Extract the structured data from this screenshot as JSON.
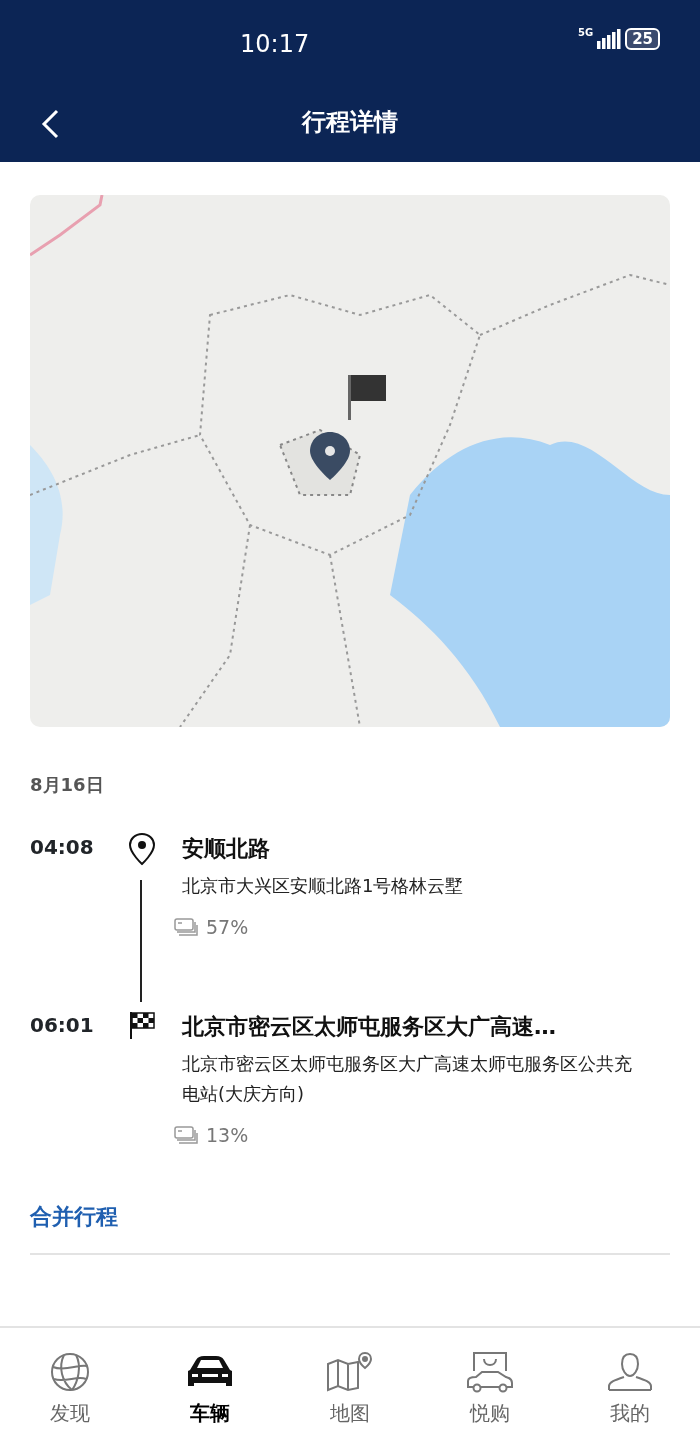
{
  "status_bar": {
    "time": "10:17",
    "network": "5G",
    "battery": "25"
  },
  "header": {
    "title": "行程详情"
  },
  "trip": {
    "date": "8月16日",
    "stops": [
      {
        "kind": "start",
        "time": "04:08",
        "name": "安顺北路",
        "address": "北京市大兴区安顺北路1号格林云墅",
        "battery": "57%"
      },
      {
        "kind": "end",
        "time": "06:01",
        "name": "北京市密云区太师屯服务区大广高速…",
        "address": "北京市密云区太师屯服务区大广高速太师屯服务区公共充电站(大庆方向)",
        "battery": "13%"
      }
    ],
    "merge_link": "合并行程"
  },
  "tabs": [
    {
      "label": "发现",
      "selected": false
    },
    {
      "label": "车辆",
      "selected": true
    },
    {
      "label": "地图",
      "selected": false
    },
    {
      "label": "悦购",
      "selected": false
    },
    {
      "label": "我的",
      "selected": false
    }
  ]
}
